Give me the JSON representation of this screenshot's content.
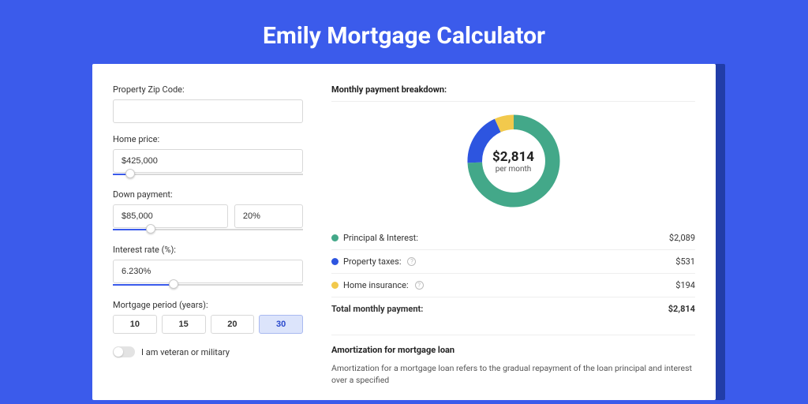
{
  "title": "Emily Mortgage Calculator",
  "form": {
    "zip_label": "Property Zip Code:",
    "zip_value": "",
    "home_price_label": "Home price:",
    "home_price_value": "$425,000",
    "home_price_slider_pct": 9,
    "down_payment_label": "Down payment:",
    "down_payment_value": "$85,000",
    "down_payment_pct_value": "20%",
    "down_payment_slider_pct": 20,
    "interest_label": "Interest rate (%):",
    "interest_value": "6.230%",
    "interest_slider_pct": 32,
    "period_label": "Mortgage period (years):",
    "periods": [
      "10",
      "15",
      "20",
      "30"
    ],
    "period_selected": "30",
    "veteran_label": "I am veteran or military",
    "veteran_on": false
  },
  "breakdown": {
    "title": "Monthly payment breakdown:",
    "center_amount": "$2,814",
    "center_sub": "per month",
    "items": [
      {
        "label": "Principal & Interest:",
        "value": "$2,089",
        "color": "#43a889",
        "info": false,
        "share": 74.2
      },
      {
        "label": "Property taxes:",
        "value": "$531",
        "color": "#2d55e0",
        "info": true,
        "share": 18.9
      },
      {
        "label": "Home insurance:",
        "value": "$194",
        "color": "#f2c94c",
        "info": true,
        "share": 6.9
      }
    ],
    "total_label": "Total monthly payment:",
    "total_value": "$2,814"
  },
  "amortization": {
    "title": "Amortization for mortgage loan",
    "body": "Amortization for a mortgage loan refers to the gradual repayment of the loan principal and interest over a specified"
  },
  "chart_data": {
    "type": "pie",
    "title": "Monthly payment breakdown",
    "series": [
      {
        "name": "Principal & Interest",
        "value": 2089,
        "color": "#43a889"
      },
      {
        "name": "Property taxes",
        "value": 531,
        "color": "#2d55e0"
      },
      {
        "name": "Home insurance",
        "value": 194,
        "color": "#f2c94c"
      }
    ],
    "total": 2814,
    "center_label": "$2,814 per month"
  }
}
